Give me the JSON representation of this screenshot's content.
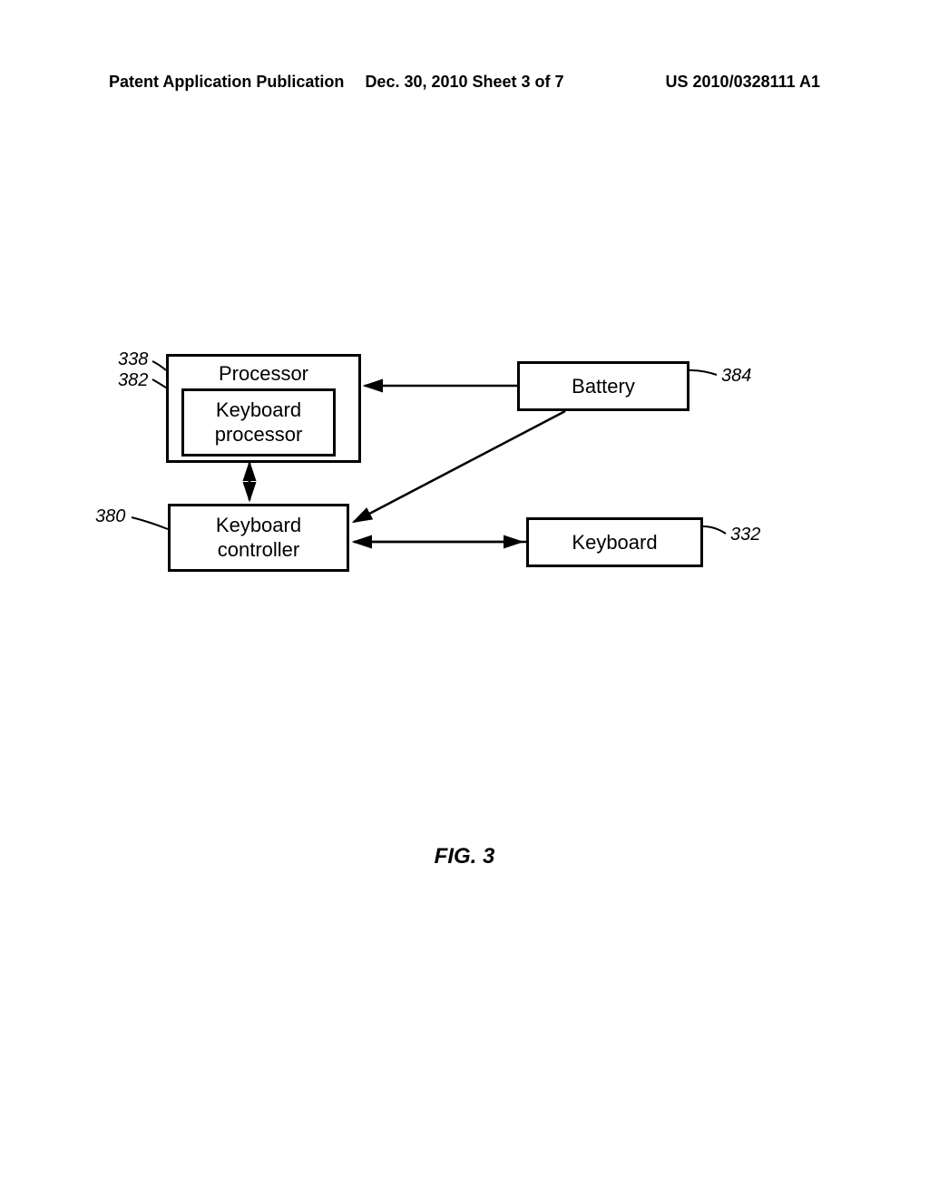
{
  "header": {
    "left": "Patent Application Publication",
    "center": "Dec. 30, 2010  Sheet 3 of 7",
    "right": "US 2010/0328111 A1"
  },
  "blocks": {
    "processor": "Processor",
    "keyboard_processor": "Keyboard\nprocessor",
    "keyboard_controller": "Keyboard\ncontroller",
    "battery": "Battery",
    "keyboard": "Keyboard"
  },
  "labels": {
    "ref338": "338",
    "ref382": "382",
    "ref380": "380",
    "ref384": "384",
    "ref332": "332"
  },
  "figure": "FIG. 3"
}
